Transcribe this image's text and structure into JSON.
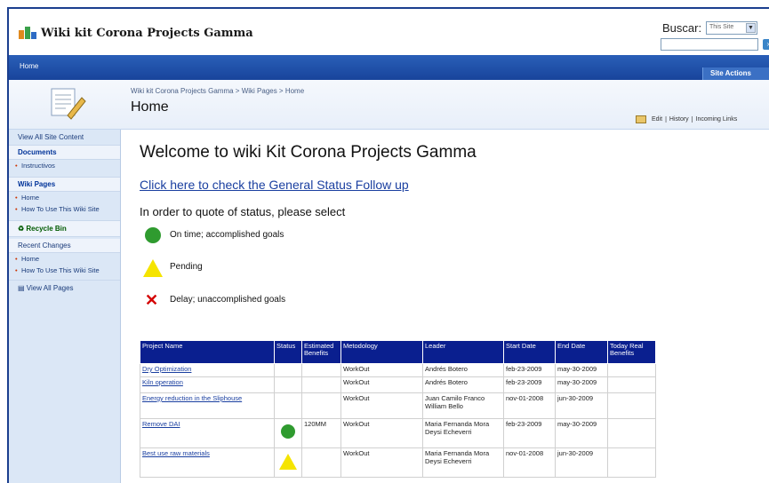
{
  "header": {
    "site_title": "Wiki kit Corona Projects Gamma",
    "search_label": "Buscar:",
    "search_scope": "This Site",
    "search_value": ""
  },
  "topnav": {
    "home_tab": "Home",
    "site_actions": "Site Actions"
  },
  "titleband": {
    "breadcrumb": "Wiki kit Corona Projects Gamma > Wiki Pages > Home",
    "page_title": "Home",
    "tools": [
      "Edit",
      "History",
      "Incoming Links"
    ]
  },
  "sidebar": {
    "view_all": "View All Site Content",
    "documents_head": "Documents",
    "documents_items": [
      "Instructivos"
    ],
    "wiki_head": "Wiki Pages",
    "wiki_items": [
      "Home",
      "How To Use This Wiki Site"
    ],
    "recycle_bin": "Recycle Bin",
    "recent_head": "Recent Changes",
    "recent_items": [
      "Home",
      "How To Use This Wiki Site"
    ],
    "view_all_pages": "View All Pages"
  },
  "main": {
    "welcome": "Welcome to wiki Kit Corona Projects Gamma",
    "status_link": "Click here to check the General Status Follow up",
    "instruction": "In order to quote of status, please select",
    "legend": {
      "on_time": "On time; accomplished goals",
      "pending": "Pending",
      "delay": "Delay; unaccomplished goals"
    }
  },
  "table": {
    "headers": {
      "project": "Project Name",
      "status": "Status",
      "benefits": "Estimated Benefits",
      "methodology": "Metodology",
      "leader": "Leader",
      "start": "Start Date",
      "end": "End Date",
      "real": "Today Real Benefits"
    },
    "rows": [
      {
        "project": "Dry Optimization",
        "status": "",
        "benefits": "",
        "methodology": "WorkOut",
        "leader": "Andrés Botero",
        "start": "feb-23-2009",
        "end": "may-30-2009",
        "real": ""
      },
      {
        "project": "Kiln operation",
        "status": "",
        "benefits": "",
        "methodology": "WorkOut",
        "leader": "Andrés Botero",
        "start": "feb-23-2009",
        "end": "may-30-2009",
        "real": ""
      },
      {
        "project": "Energy reduction in the Sliphouse",
        "status": "",
        "benefits": "",
        "methodology": "WorkOut",
        "leader": "Juan Camilo Franco William Bello",
        "start": "nov-01-2008",
        "end": "jun-30-2009",
        "real": ""
      },
      {
        "project": "Remove DAI",
        "status": "green",
        "benefits": "120MM",
        "methodology": "WorkOut",
        "leader": "Maria Fernanda Mora Deysi Echeverri",
        "start": "feb-23-2009",
        "end": "may-30-2009",
        "real": ""
      },
      {
        "project": "Best use raw materials",
        "status": "yellow",
        "benefits": "",
        "methodology": "WorkOut",
        "leader": "Maria Fernanda Mora Deysi Echeverri",
        "start": "nov-01-2008",
        "end": "jun-30-2009",
        "real": ""
      }
    ]
  }
}
